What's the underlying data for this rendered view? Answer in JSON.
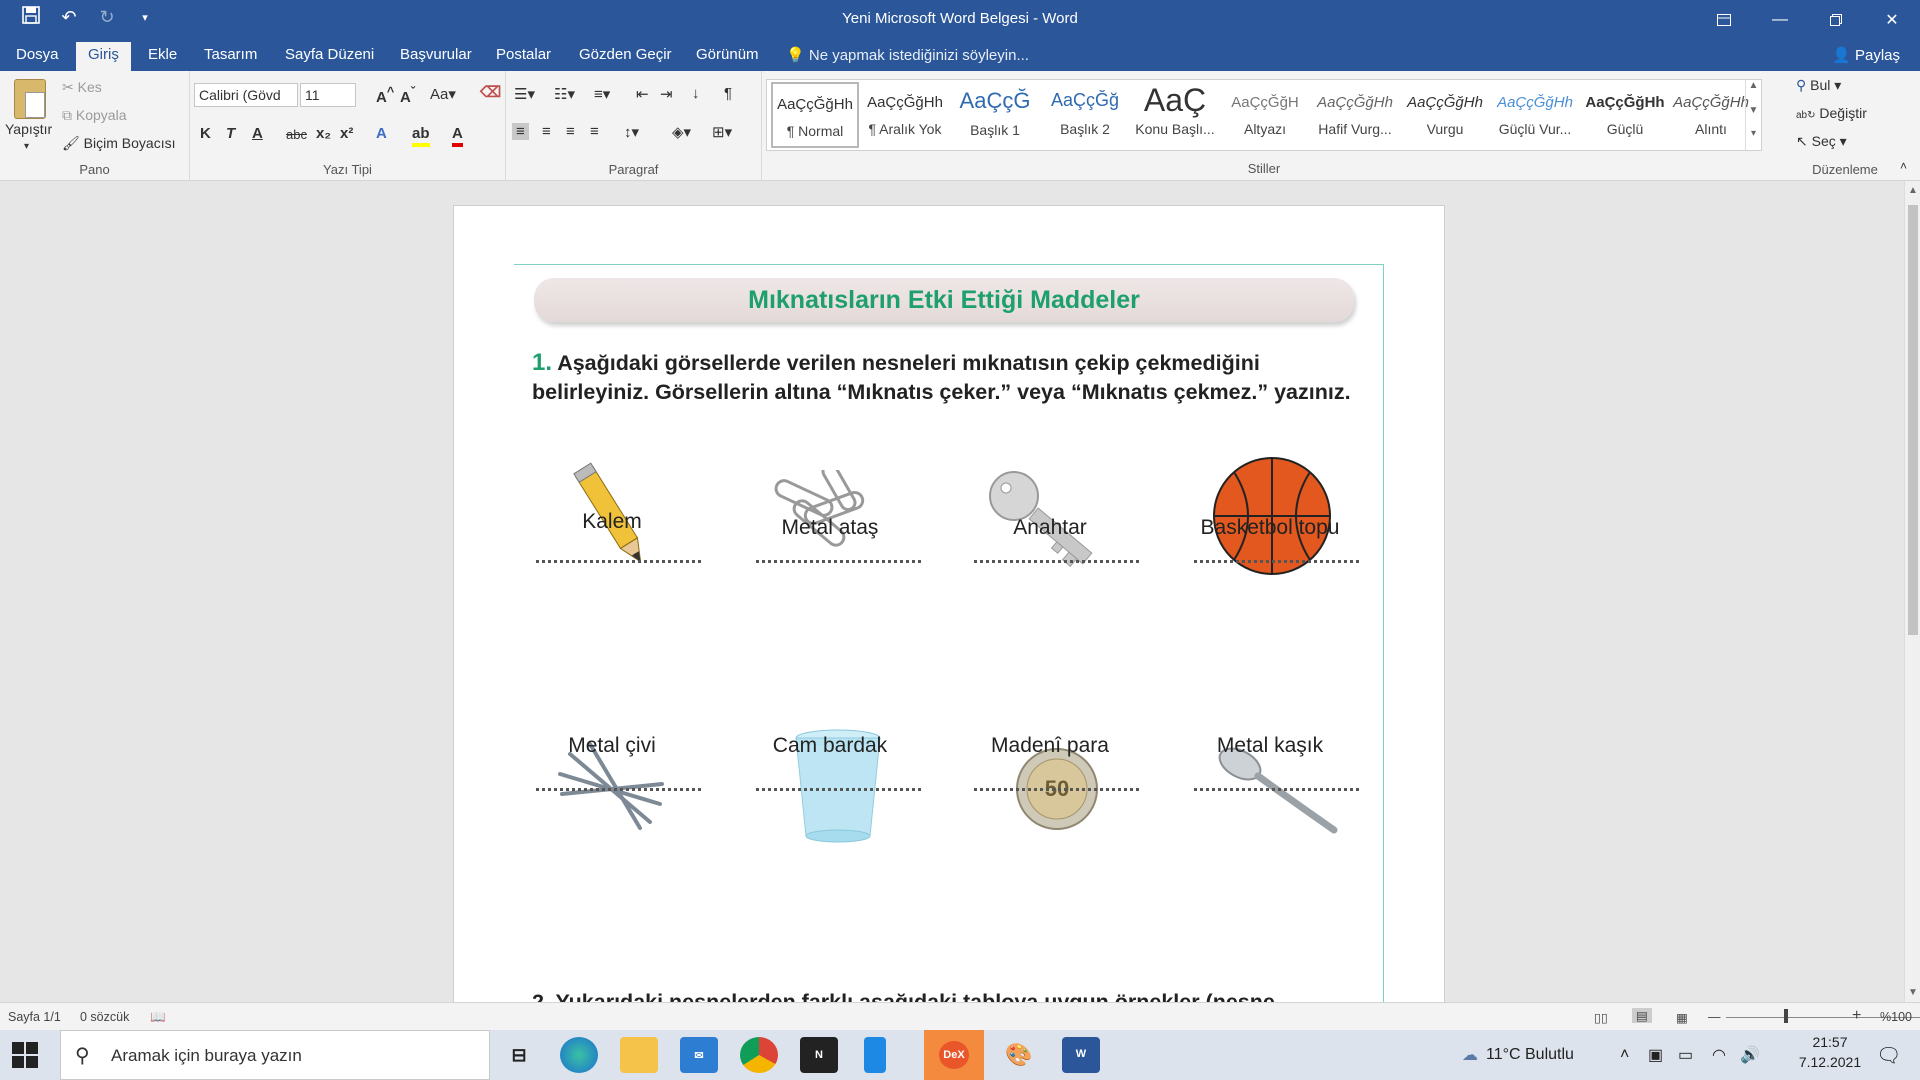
{
  "window": {
    "title": "Yeni Microsoft Word Belgesi - Word",
    "qat": {
      "save_icon": "save-icon",
      "undo_icon": "undo-icon",
      "redo_icon": "redo-icon",
      "customize_icon": "chevron-down-icon"
    },
    "controls": [
      "ribbon-display-icon",
      "minimize-icon",
      "restore-icon",
      "close-icon"
    ]
  },
  "tabs": [
    "Dosya",
    "Giriş",
    "Ekle",
    "Tasarım",
    "Sayfa Düzeni",
    "Başvurular",
    "Postalar",
    "Gözden Geçir",
    "Görünüm"
  ],
  "active_tab": "Giriş",
  "tell_me": "Ne yapmak istediğinizi söyleyin...",
  "share": "Paylaş",
  "ribbon": {
    "clipboard": {
      "label": "Pano",
      "paste": "Yapıştır",
      "cut": "Kes",
      "copy": "Kopyala",
      "format_painter": "Biçim Boyacısı"
    },
    "font": {
      "label": "Yazı Tipi",
      "font_name": "Calibri (Gövd",
      "font_size": "11",
      "bold": "K",
      "italic": "T",
      "underline": "A",
      "strike": "abc",
      "sub": "x₂",
      "sup": "x²",
      "case": "Aa"
    },
    "paragraph": {
      "label": "Paragraf"
    },
    "styles": {
      "label": "Stiller",
      "items": [
        {
          "sample": "AaÇçĞğHh",
          "name": "¶ Normal"
        },
        {
          "sample": "AaÇçĞğHh",
          "name": "¶ Aralık Yok"
        },
        {
          "sample": "AaÇçĞ",
          "name": "Başlık 1"
        },
        {
          "sample": "AaÇçĞğ",
          "name": "Başlık 2"
        },
        {
          "sample": "AaÇ",
          "name": "Konu Başlı..."
        },
        {
          "sample": "AaÇçĞğH",
          "name": "Altyazı"
        },
        {
          "sample": "AaÇçĞğHh",
          "name": "Hafif Vurg..."
        },
        {
          "sample": "AaÇçĞğHh",
          "name": "Vurgu"
        },
        {
          "sample": "AaÇçĞğHh",
          "name": "Güçlü Vur..."
        },
        {
          "sample": "AaÇçĞğHh",
          "name": "Güçlü"
        },
        {
          "sample": "AaÇçĞğHh",
          "name": "Alıntı"
        }
      ]
    },
    "editing": {
      "label": "Düzenleme",
      "find": "Bul",
      "replace": "Değiştir",
      "select": "Seç"
    }
  },
  "document": {
    "heading": "Mıknatısların Etki Ettiği Maddeler",
    "q1_num": "1.",
    "q1_text": "Aşağıdaki görsellerde verilen nesneleri mıknatısın çekip çekmediğini belirleyiniz. Görsellerin altına “Mıknatıs çeker.” veya “Mıknatıs çekmez.” yazınız.",
    "items_row1": [
      "Kalem",
      "Metal ataş",
      "Anahtar",
      "Basketbol topu"
    ],
    "items_row2": [
      "Metal çivi",
      "Cam bardak",
      "Madenî para",
      "Metal kaşık"
    ],
    "coin_text": "50",
    "q2_partial": "2. Yukarıdaki nesnelerden farklı aşağıdaki tabloya uygun örnekler (nesne"
  },
  "status": {
    "page": "Sayfa 1/1",
    "words": "0 sözcük",
    "zoom": "%100"
  },
  "taskbar": {
    "search_placeholder": "Aramak için buraya yazın",
    "weather": "11°C  Bulutlu",
    "time": "21:57",
    "date": "7.12.2021",
    "dex_label": "DeX"
  },
  "colors": {
    "word_blue": "#2b579a",
    "heading_green": "#1ea06d",
    "frame_teal": "#7fd1c4"
  }
}
